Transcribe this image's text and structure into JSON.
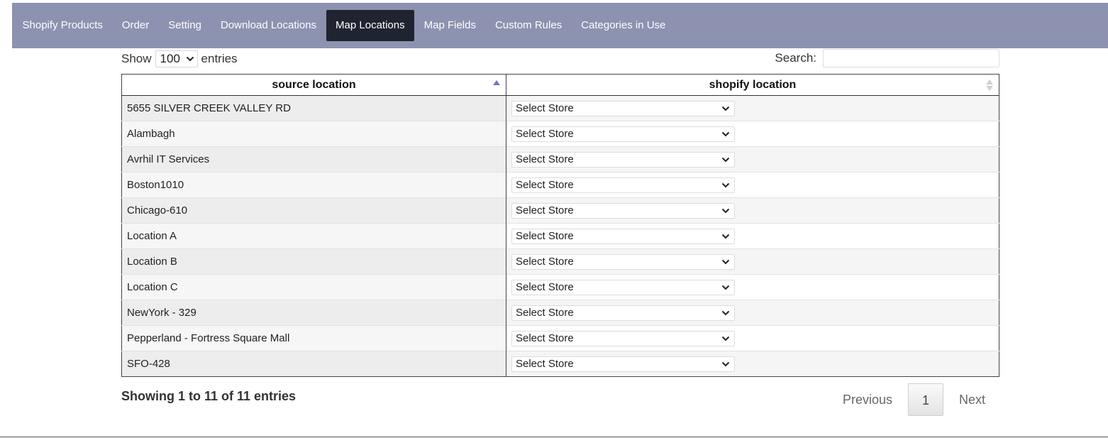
{
  "nav": {
    "items": [
      {
        "label": "Shopify Products",
        "name": "nav-shopify-products"
      },
      {
        "label": "Order",
        "name": "nav-order"
      },
      {
        "label": "Setting",
        "name": "nav-setting"
      },
      {
        "label": "Download Locations",
        "name": "nav-download-locations"
      },
      {
        "label": "Map Locations",
        "name": "nav-map-locations",
        "active": true
      },
      {
        "label": "Map Fields",
        "name": "nav-map-fields"
      },
      {
        "label": "Custom Rules",
        "name": "nav-custom-rules"
      },
      {
        "label": "Categories in Use",
        "name": "nav-categories-in-use"
      }
    ]
  },
  "controls": {
    "show_label": "Show",
    "entries_label": "entries",
    "page_length": "100",
    "search_label": "Search:",
    "search_value": ""
  },
  "table": {
    "headers": {
      "source": "source location",
      "shopify": "shopify location"
    },
    "rows": [
      {
        "source": "5655 SILVER CREEK VALLEY RD",
        "store": "Select Store"
      },
      {
        "source": "Alambagh",
        "store": "Select Store"
      },
      {
        "source": "Avrhil IT Services",
        "store": "Select Store"
      },
      {
        "source": "Boston1010",
        "store": "Select Store"
      },
      {
        "source": "Chicago-610",
        "store": "Select Store"
      },
      {
        "source": "Location A",
        "store": "Select Store"
      },
      {
        "source": "Location B",
        "store": "Select Store"
      },
      {
        "source": "Location C",
        "store": "Select Store"
      },
      {
        "source": "NewYork - 329",
        "store": "Select Store"
      },
      {
        "source": "Pepperland - Fortress Square Mall",
        "store": "Select Store"
      },
      {
        "source": "SFO-428",
        "store": "Select Store"
      }
    ]
  },
  "footer": {
    "info": "Showing 1 to 11 of 11 entries",
    "previous": "Previous",
    "current_page": "1",
    "next": "Next"
  },
  "colors": {
    "nav_bg": "#8d92b0",
    "nav_active_bg": "#1f2430",
    "sort_active": "#6a74c9",
    "sort_inactive": "#d0d0d0"
  },
  "icons": {
    "sort_asc": "sort-asc-icon",
    "sort_both": "sort-both-icon",
    "dropdown": "chevron-down-icon"
  }
}
